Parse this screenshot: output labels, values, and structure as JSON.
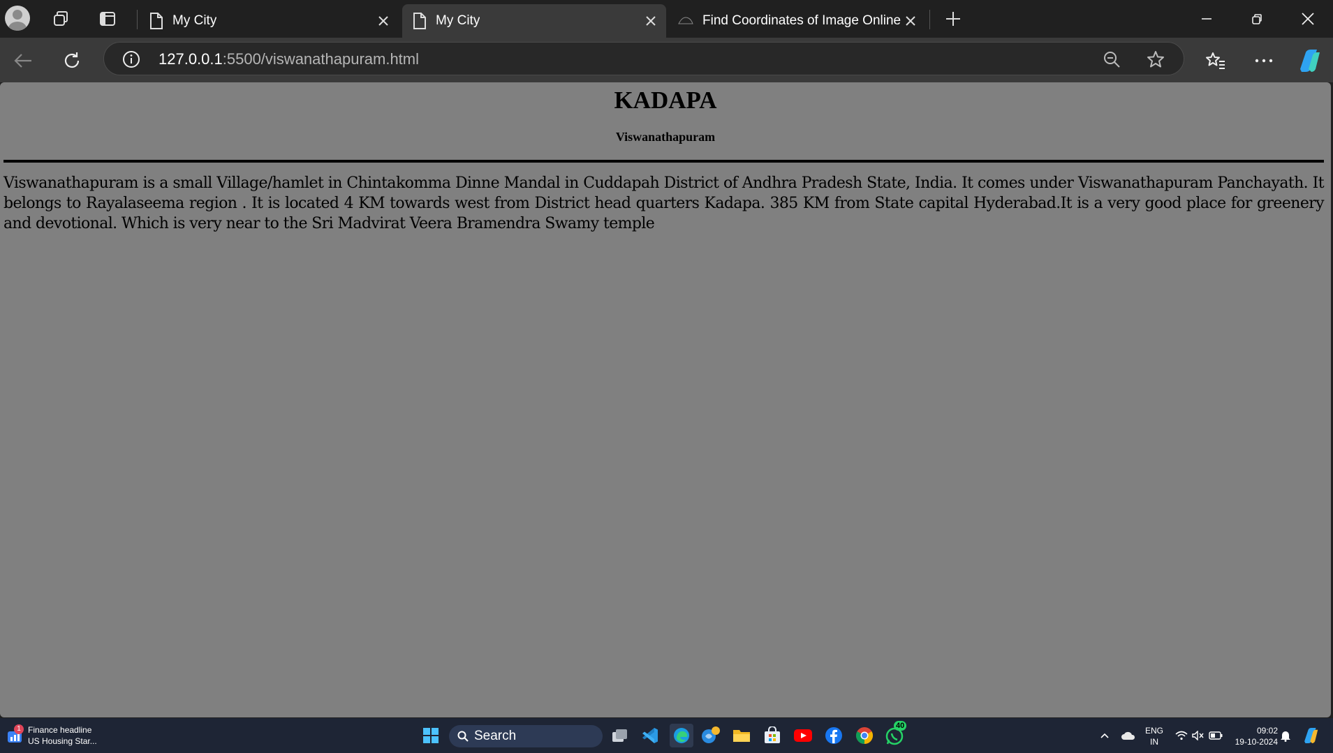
{
  "tabs": [
    {
      "title": "My City",
      "active": false
    },
    {
      "title": "My City",
      "active": true
    },
    {
      "title": "Find Coordinates of Image Online",
      "active": false
    }
  ],
  "address": {
    "host": "127.0.0.1",
    "path": ":5500/viswanathapuram.html"
  },
  "page": {
    "heading": "KADAPA",
    "subheading": "Viswanathapuram",
    "paragraph": "Viswanathapuram is a small Village/hamlet in Chintakomma Dinne Mandal in Cuddapah District of Andhra Pradesh State, India. It comes under Viswanathapuram Panchayath. It belongs to Rayalaseema region . It is located 4 KM towards west from District head quarters Kadapa. 385 KM from State capital Hyderabad.It is a very good place for greenery and devotional. Which is very near to the Sri Madvirat Veera Bramendra Swamy temple"
  },
  "taskbar": {
    "news_badge": "1",
    "news_title": "Finance headline",
    "news_sub": "US Housing Star...",
    "search_label": "Search",
    "whatsapp_badge": "40",
    "lang_top": "ENG",
    "lang_bottom": "IN",
    "time": "09:02",
    "date": "19-10-2024"
  },
  "icons": [
    "profile-icon",
    "workspaces-icon",
    "tab-actions-icon",
    "page-icon",
    "close-icon",
    "plus-icon",
    "minimize-icon",
    "restore-icon",
    "back-icon",
    "refresh-icon",
    "info-icon",
    "zoom-out-icon",
    "star-icon",
    "favorites-icon",
    "more-icon",
    "copilot-icon",
    "windows-start-icon",
    "search-icon",
    "task-view-icon",
    "vscode-icon",
    "edge-icon",
    "widgets-icon",
    "file-explorer-icon",
    "store-icon",
    "youtube-icon",
    "facebook-icon",
    "chrome-icon",
    "whatsapp-icon",
    "chevron-up-icon",
    "cloud-icon",
    "wifi-icon",
    "mute-icon",
    "battery-icon",
    "bell-icon"
  ],
  "colors": {
    "page_bg": "#808080",
    "chrome_bg": "#202020",
    "toolbar_bg": "#3a3a3a",
    "taskbar_bg": "#1e2535"
  }
}
